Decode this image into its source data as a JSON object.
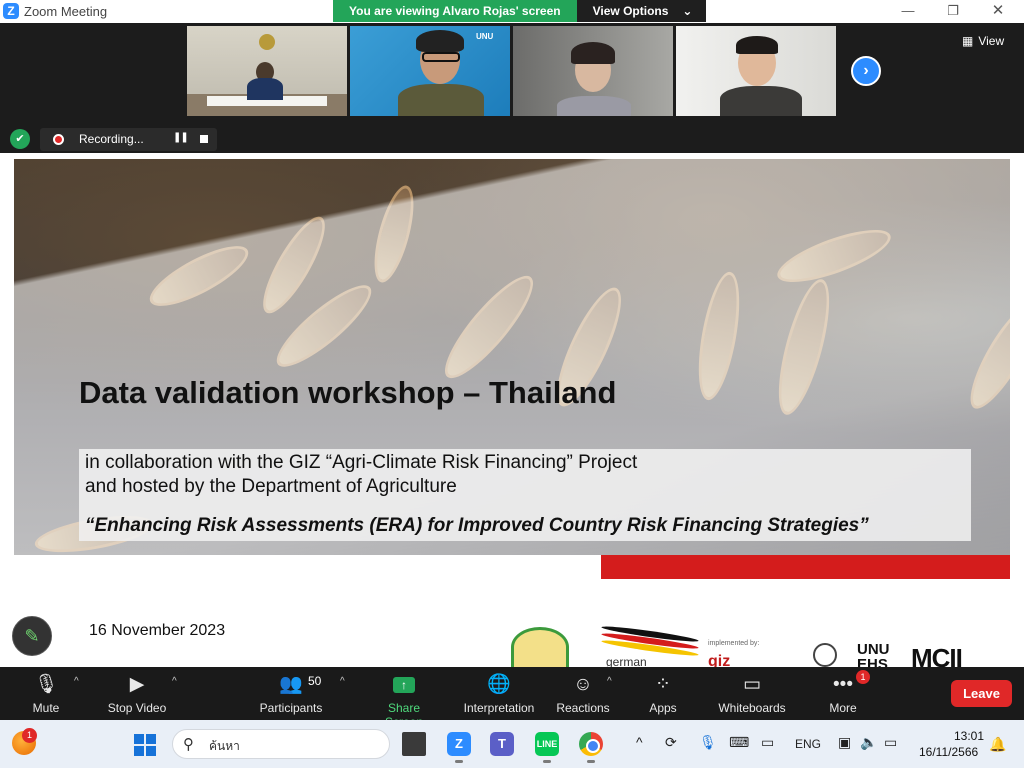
{
  "window": {
    "title": "Zoom Meeting",
    "viewing_banner": "You are viewing Alvaro Rojas' screen",
    "view_options_label": "View Options",
    "min_glyph": "—",
    "max_glyph": "❐",
    "close_glyph": "✕"
  },
  "gallery": {
    "view_label": "View",
    "next_glyph": "›"
  },
  "recording": {
    "label": "Recording...",
    "pause_glyph": "❚❚"
  },
  "slide": {
    "title": "Data validation workshop – Thailand",
    "subtitle_line_1": "in collaboration with the GIZ “Agri-Climate Risk Financing” Project",
    "subtitle_line_2": "and hosted by the Department of Agriculture",
    "subtitle_line_3": "“Enhancing Risk Assessments (ERA) for Improved Country Risk Financing Strategies”",
    "date": "16 November 2023",
    "logos": {
      "german_text": "german",
      "implemented_by": "implemented by:",
      "giz": "giz",
      "unu_line_1": "UNU",
      "unu_line_2": "EHS",
      "mcii": "MCII"
    },
    "annotate_glyph": "✎"
  },
  "toolbar": {
    "mute": "Mute",
    "stop_video": "Stop Video",
    "participants": "Participants",
    "participants_count": "50",
    "share_screen": "Share Screen",
    "interpretation": "Interpretation",
    "reactions": "Reactions",
    "apps": "Apps",
    "whiteboards": "Whiteboards",
    "more": "More",
    "more_badge": "1",
    "leave": "Leave",
    "caret": "^"
  },
  "taskbar": {
    "notification_badge": "1",
    "search_placeholder": "ค้นหา",
    "zoom_glyph": "Z",
    "teams_glyph": "T",
    "line_glyph": "LINE",
    "language": "ENG",
    "time": "13:01",
    "date": "16/11/2566"
  },
  "colors": {
    "zoom_blue": "#2d8cff",
    "banner_green": "#23a559",
    "leave_red": "#e02828",
    "toolbar_bg": "#1a1a1a"
  }
}
